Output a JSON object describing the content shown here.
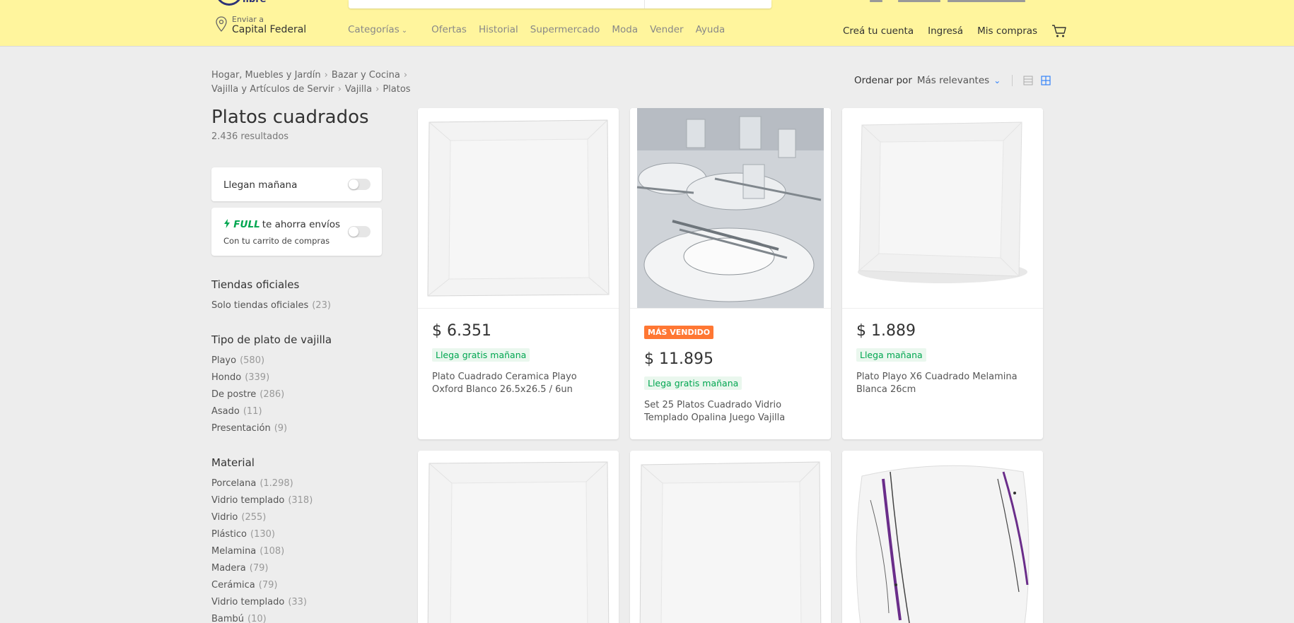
{
  "header": {
    "logo_text": "libre",
    "location": {
      "small": "Enviar a",
      "main": "Capital Federal"
    },
    "nav": [
      "Categorías",
      "Ofertas",
      "Historial",
      "Supermercado",
      "Moda",
      "Vender",
      "Ayuda"
    ],
    "user_nav": [
      "Creá tu cuenta",
      "Ingresá",
      "Mis compras"
    ]
  },
  "breadcrumb": {
    "line1": [
      "Hogar, Muebles y Jardín",
      "Bazar y Cocina"
    ],
    "line2": [
      "Vajilla y Artículos de Servir",
      "Vajilla",
      "Platos"
    ]
  },
  "sort": {
    "label": "Ordenar por",
    "value": "Más relevantes"
  },
  "title": "Platos cuadrados",
  "results": "2.436 resultados",
  "filters": {
    "tomorrow": "Llegan mañana",
    "full_brand": "FULL",
    "full_text": "te ahorra envíos",
    "full_sub": "Con tu carrito de compras"
  },
  "sections": [
    {
      "heading": "Tiendas oficiales",
      "items": [
        {
          "label": "Solo tiendas oficiales",
          "count": "(23)"
        }
      ]
    },
    {
      "heading": "Tipo de plato de vajilla",
      "items": [
        {
          "label": "Playo",
          "count": "(580)"
        },
        {
          "label": "Hondo",
          "count": "(339)"
        },
        {
          "label": "De postre",
          "count": "(286)"
        },
        {
          "label": "Asado",
          "count": "(11)"
        },
        {
          "label": "Presentación",
          "count": "(9)"
        }
      ]
    },
    {
      "heading": "Material",
      "items": [
        {
          "label": "Porcelana",
          "count": "(1.298)"
        },
        {
          "label": "Vidrio templado",
          "count": "(318)"
        },
        {
          "label": "Vidrio",
          "count": "(255)"
        },
        {
          "label": "Plástico",
          "count": "(130)"
        },
        {
          "label": "Melamina",
          "count": "(108)"
        },
        {
          "label": "Madera",
          "count": "(79)"
        },
        {
          "label": "Cerámica",
          "count": "(79)"
        },
        {
          "label": "Vidrio templado",
          "count": "(33)"
        },
        {
          "label": "Bambú",
          "count": "(10)"
        }
      ]
    }
  ],
  "products": [
    {
      "price": "$ 6.351",
      "shipping": "Llega gratis mañana",
      "title": "Plato Cuadrado Ceramica Playo Oxford Blanco 26.5x26.5 / 6un",
      "badge": ""
    },
    {
      "price": "$ 11.895",
      "shipping": "Llega gratis mañana",
      "title": "Set 25 Platos Cuadrado Vidrio Templado Opalina Juego Vajilla",
      "badge": "MÁS VENDIDO"
    },
    {
      "price": "$ 1.889",
      "shipping": "Llega mañana",
      "title": "Plato Playo X6 Cuadrado Melamina Blanca 26cm",
      "badge": ""
    }
  ],
  "colors": {
    "header_bg": "#fff59d",
    "accent": "#3483fa",
    "green": "#00a650",
    "badge": "#ff7733"
  },
  "icons": [
    "location-pin-icon",
    "chevron-down-icon",
    "cart-icon",
    "list-view-icon",
    "grid-view-icon",
    "lightning-icon"
  ]
}
